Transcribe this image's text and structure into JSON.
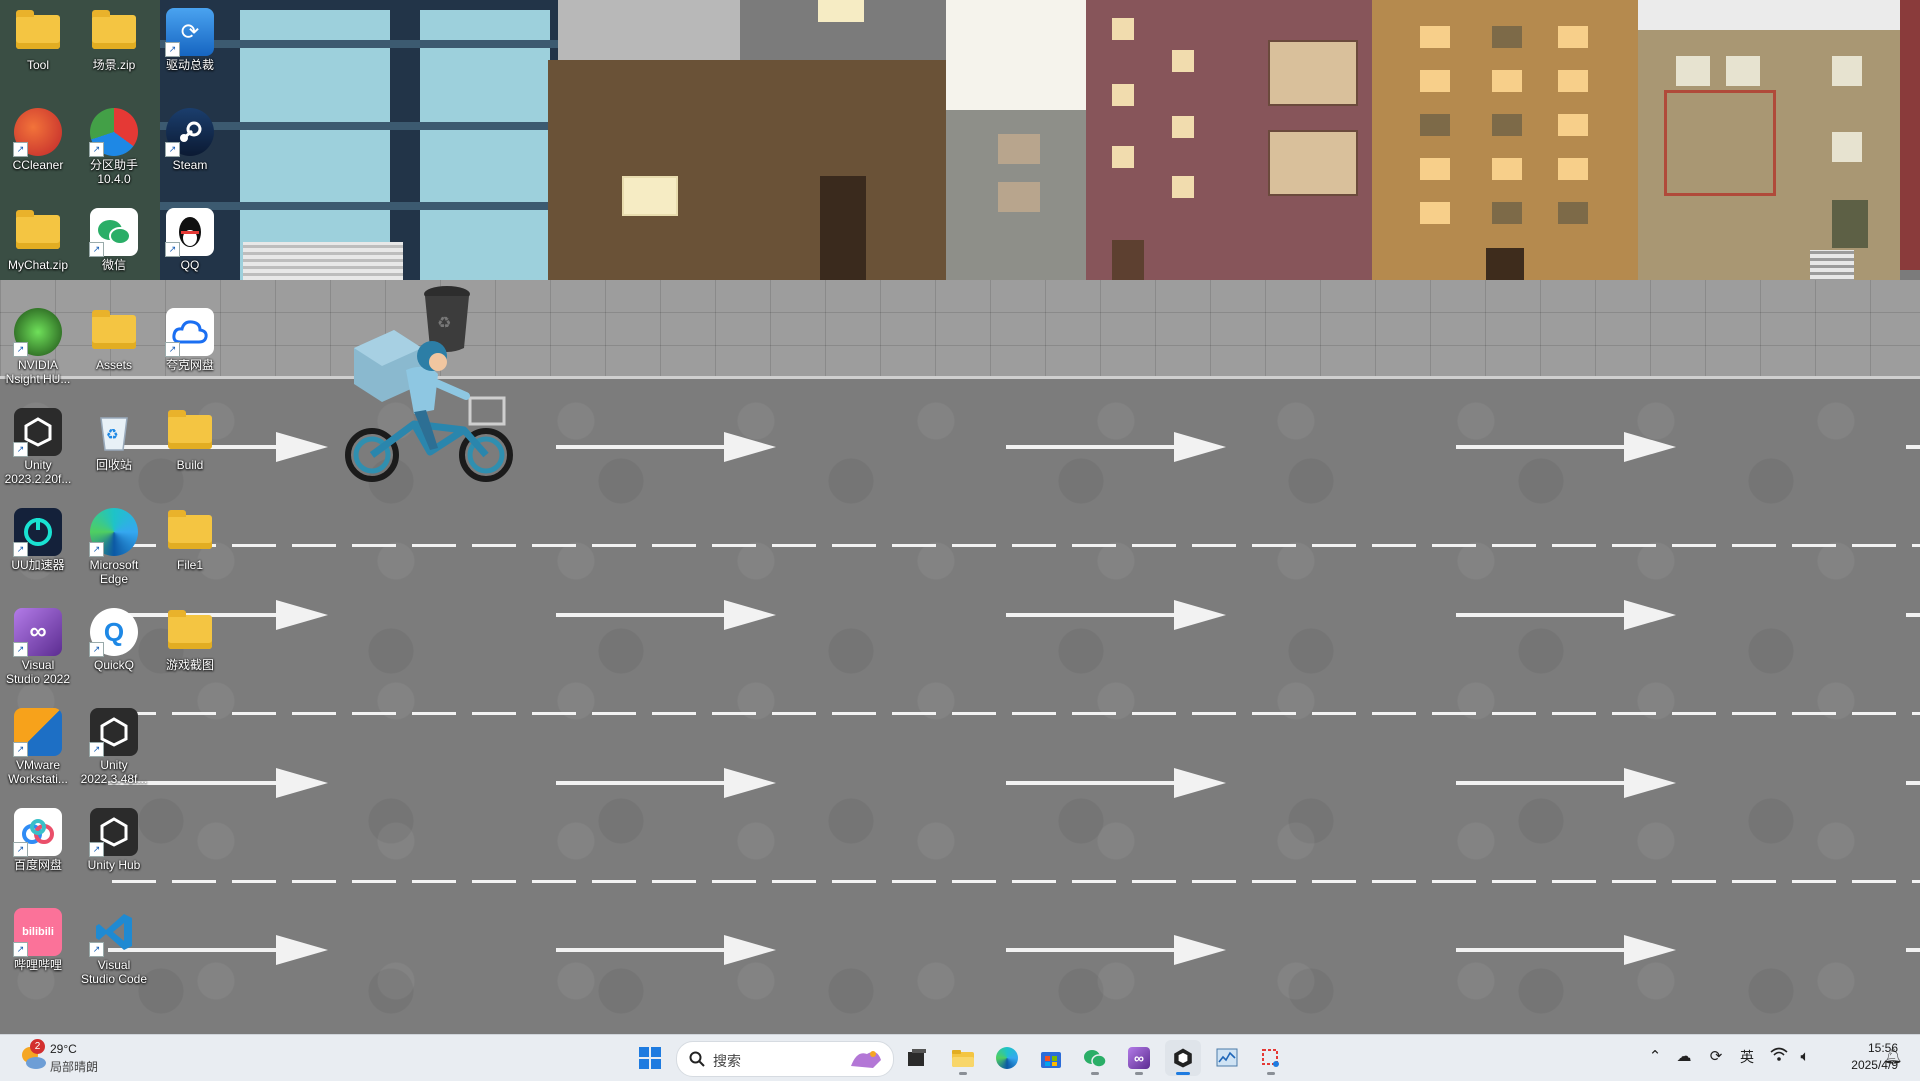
{
  "desktop": {
    "icons": [
      {
        "label": "Tool"
      },
      {
        "label": "场景.zip"
      },
      {
        "label": "驱动总裁"
      },
      {
        "label": "CCleaner"
      },
      {
        "label": "分区助手\n10.4.0"
      },
      {
        "label": "Steam"
      },
      {
        "label": "MyChat.zip"
      },
      {
        "label": "微信"
      },
      {
        "label": "QQ"
      },
      {
        "label": "NVIDIA\nNsight HU..."
      },
      {
        "label": "Assets"
      },
      {
        "label": "夸克网盘"
      },
      {
        "label": "Unity\n2023.2.20f..."
      },
      {
        "label": "回收站"
      },
      {
        "label": "Build"
      },
      {
        "label": "UU加速器"
      },
      {
        "label": "Microsoft\nEdge"
      },
      {
        "label": "File1"
      },
      {
        "label": "Visual\nStudio 2022"
      },
      {
        "label": "QuickQ"
      },
      {
        "label": "游戏截图"
      },
      {
        "label": "VMware\nWorkstati..."
      },
      {
        "label": "Unity\n2022.3.48f..."
      },
      {
        "label": "百度网盘"
      },
      {
        "label": "Unity Hub"
      },
      {
        "label": "哔哩哔哩"
      },
      {
        "label": "Visual\nStudio Code"
      }
    ]
  },
  "taskbar": {
    "weather": {
      "temp": "29°C",
      "desc": "局部晴朗",
      "badge": "2"
    },
    "search_placeholder": "搜索",
    "apps": [
      "start-icon",
      "file-explorer-icon",
      "edge-icon",
      "store-icon",
      "wechat-icon",
      "visual-studio-icon",
      "unity-icon",
      "task-manager-icon",
      "snipping-tool-icon"
    ],
    "tray": {
      "ime": "英"
    },
    "clock": {
      "time": "15:56",
      "date": "2025/4/9"
    }
  }
}
